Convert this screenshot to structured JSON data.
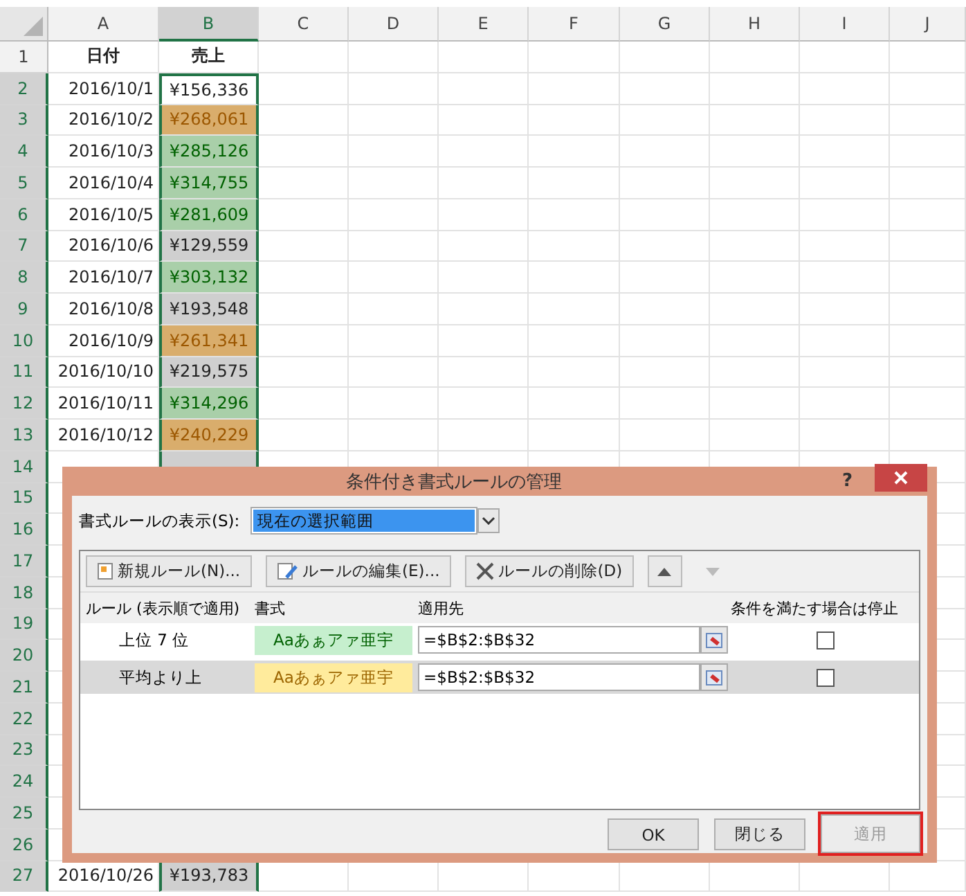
{
  "columns": [
    {
      "label": "A",
      "selected": false
    },
    {
      "label": "B",
      "selected": true
    },
    {
      "label": "C",
      "selected": false
    },
    {
      "label": "D",
      "selected": false
    },
    {
      "label": "E",
      "selected": false
    },
    {
      "label": "F",
      "selected": false
    },
    {
      "label": "G",
      "selected": false
    },
    {
      "label": "H",
      "selected": false
    },
    {
      "label": "I",
      "selected": false
    },
    {
      "label": "J",
      "selected": false
    }
  ],
  "rows": [
    {
      "number": "1",
      "selected": false,
      "kind": "heading",
      "date": "日付",
      "sales": "売上"
    },
    {
      "number": "2",
      "selected": true,
      "kind": "data",
      "date": "2016/10/1",
      "sales": "¥156,336",
      "color": "#ffffff",
      "active": true
    },
    {
      "number": "3",
      "selected": true,
      "kind": "data",
      "date": "2016/10/2",
      "sales": "¥268,061",
      "color": "#d9ad6c",
      "active": false
    },
    {
      "number": "4",
      "selected": true,
      "kind": "data",
      "date": "2016/10/3",
      "sales": "¥285,126",
      "color": "#a9cfa9",
      "active": false
    },
    {
      "number": "5",
      "selected": true,
      "kind": "data",
      "date": "2016/10/4",
      "sales": "¥314,755",
      "color": "#a9cfa9",
      "active": false
    },
    {
      "number": "6",
      "selected": true,
      "kind": "data",
      "date": "2016/10/5",
      "sales": "¥281,609",
      "color": "#a9cfa9",
      "active": false
    },
    {
      "number": "7",
      "selected": true,
      "kind": "data",
      "date": "2016/10/6",
      "sales": "¥129,559",
      "color": "#cfcfcf",
      "active": false
    },
    {
      "number": "8",
      "selected": true,
      "kind": "data",
      "date": "2016/10/7",
      "sales": "¥303,132",
      "color": "#a9cfa9",
      "active": false
    },
    {
      "number": "9",
      "selected": true,
      "kind": "data",
      "date": "2016/10/8",
      "sales": "¥193,548",
      "color": "#cfcfcf",
      "active": false
    },
    {
      "number": "10",
      "selected": true,
      "kind": "data",
      "date": "2016/10/9",
      "sales": "¥261,341",
      "color": "#d9ad6c",
      "active": false
    },
    {
      "number": "11",
      "selected": true,
      "kind": "data",
      "date": "2016/10/10",
      "sales": "¥219,575",
      "color": "#cfcfcf",
      "active": false
    },
    {
      "number": "12",
      "selected": true,
      "kind": "data",
      "date": "2016/10/11",
      "sales": "¥314,296",
      "color": "#a9cfa9",
      "active": false
    },
    {
      "number": "13",
      "selected": true,
      "kind": "data",
      "date": "2016/10/12",
      "sales": "¥240,229",
      "color": "#d9ad6c",
      "active": false
    },
    {
      "number": "14",
      "selected": true,
      "kind": "covered"
    },
    {
      "number": "15",
      "selected": true,
      "kind": "covered"
    },
    {
      "number": "16",
      "selected": true,
      "kind": "covered"
    },
    {
      "number": "17",
      "selected": true,
      "kind": "covered"
    },
    {
      "number": "18",
      "selected": true,
      "kind": "covered"
    },
    {
      "number": "19",
      "selected": true,
      "kind": "covered"
    },
    {
      "number": "20",
      "selected": true,
      "kind": "covered"
    },
    {
      "number": "21",
      "selected": true,
      "kind": "covered"
    },
    {
      "number": "22",
      "selected": true,
      "kind": "covered"
    },
    {
      "number": "23",
      "selected": true,
      "kind": "covered"
    },
    {
      "number": "24",
      "selected": true,
      "kind": "covered"
    },
    {
      "number": "25",
      "selected": true,
      "kind": "covered"
    },
    {
      "number": "26",
      "selected": true,
      "kind": "covered"
    },
    {
      "number": "27",
      "selected": true,
      "kind": "data",
      "date": "2016/10/26",
      "sales": "¥193,783",
      "color": "#cfcfcf",
      "active": false
    }
  ],
  "dialog": {
    "title": "条件付き書式ルールの管理",
    "help": "?",
    "show_rules": {
      "label": "書式ルールの表示(S):",
      "value": "現在の選択範囲"
    },
    "toolbar": [
      {
        "kind": "new",
        "label": "新規ルール(N)...",
        "disabled": false
      },
      {
        "kind": "edit",
        "label": "ルールの編集(E)...",
        "disabled": false
      },
      {
        "kind": "delete",
        "label": "ルールの削除(D)",
        "disabled": false
      },
      {
        "kind": "up",
        "disabled": false
      },
      {
        "kind": "down",
        "disabled": true
      }
    ],
    "columns": [
      "ルール (表示順で適用)",
      "書式",
      "適用先",
      "条件を満たす場合は停止"
    ],
    "rules": [
      {
        "name": "上位 7 位",
        "preview": "Aaあぁアァ亜宇",
        "color": "#c6efce",
        "applies_to": "=$B$2:$B$32",
        "stop": false,
        "selected": false
      },
      {
        "name": "平均より上",
        "preview": "Aaあぁアァ亜宇",
        "color": "#ffeb9c",
        "applies_to": "=$B$2:$B$32",
        "stop": false,
        "selected": true
      }
    ],
    "buttons": [
      {
        "label": "OK",
        "disabled": false,
        "highlighted": false
      },
      {
        "label": "閉じる",
        "disabled": false,
        "highlighted": false
      },
      {
        "label": "適用",
        "disabled": true,
        "highlighted": true
      }
    ]
  }
}
